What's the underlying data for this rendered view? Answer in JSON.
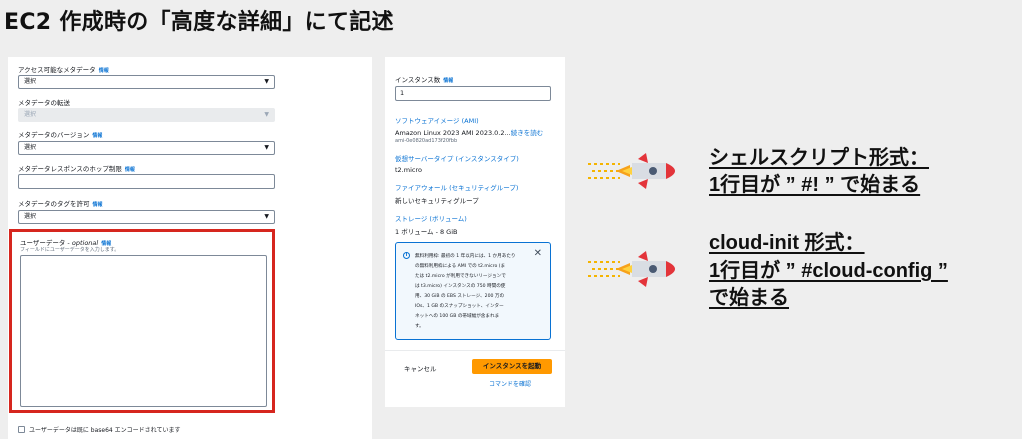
{
  "title": "EC2 作成時の「高度な詳細」にて記述",
  "left_panel": {
    "metadata_accessible": {
      "label": "アクセス可能なメタデータ",
      "info": "情報",
      "value": "選択"
    },
    "metadata_transport": {
      "label": "メタデータの転送",
      "value": "選択"
    },
    "metadata_version": {
      "label": "メタデータのバージョン",
      "info": "情報",
      "value": "選択"
    },
    "metadata_hop_limit": {
      "label": "メタデータレスポンスのホップ制限",
      "info": "情報",
      "value": ""
    },
    "metadata_tags": {
      "label": "メタデータのタグを許可",
      "info": "情報",
      "value": "選択"
    },
    "user_data": {
      "label": "ユーザーデータ - ",
      "optional": "optional",
      "info": "情報",
      "description": "フィールドにユーザーデータを入力します。",
      "value": ""
    },
    "base64_checkbox": "ユーザーデータは既に base64 エンコードされています"
  },
  "right_panel": {
    "instance_count_label": "インスタンス数",
    "info": "情報",
    "instance_count_value": "1",
    "ami_link": "ソフトウェアイメージ (AMI)",
    "ami_value": "Amazon Linux 2023 AMI 2023.0.2...",
    "ami_more": "続きを読む",
    "ami_id": "ami-0e0820ad173f20fbb",
    "instance_type_link": "仮想サーバータイプ (インスタンスタイプ)",
    "instance_type_value": "t2.micro",
    "firewall_link": "ファイアウォール (セキュリティグループ)",
    "firewall_value": "新しいセキュリティグループ",
    "storage_link": "ストレージ (ボリューム)",
    "storage_value": "1 ボリューム - 8 GiB",
    "free_tier_lines": [
      "無料利用枠: 最初の 1 年以内には、1 か月あたり",
      "の無料利用枠による AMI での t2.micro (ま",
      "たは t2.micro が利用できないリージョンで",
      "は t3.micro) インスタンスの 750 時間の使",
      "用、30 GiB の EBS ストレージ、200 万の",
      "IOs、1 GB のスナップショット、インター",
      "ネットへの 100 GB の帯域幅が含まれま",
      "す。"
    ],
    "cancel": "キャンセル",
    "launch": "インスタンスを起動",
    "review_commands": "コマンドを確認"
  },
  "annotations": {
    "shell_line1": "シェルスクリプト形式：",
    "shell_line2": "1行目が ” #! ” で始まる",
    "cloudinit_line1": "cloud-init 形式：",
    "cloudinit_line2": "1行目が ” #cloud-config ”",
    "cloudinit_line3": "で始まる"
  },
  "colors": {
    "highlight_border": "#d6261e",
    "launch_button": "#ff9900",
    "link": "#0972d3"
  }
}
